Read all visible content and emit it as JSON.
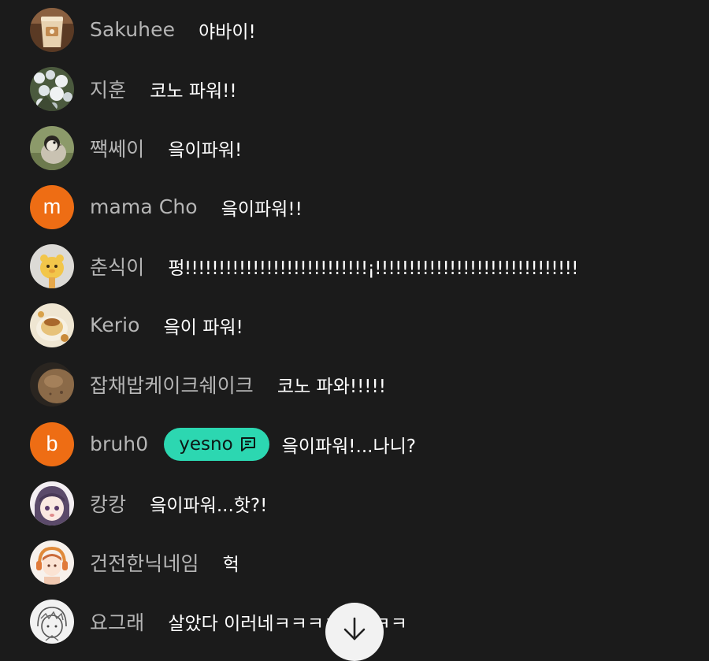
{
  "chat": {
    "messages": [
      {
        "nickname": "Sakuhee",
        "text": "야바이!",
        "avatar": "cup-avatar"
      },
      {
        "nickname": "지훈",
        "text": "코노 파워!!",
        "avatar": "flowers-avatar"
      },
      {
        "nickname": "짹쎄이",
        "text": "읔이파워!",
        "avatar": "bird-avatar"
      },
      {
        "nickname": "mama Cho",
        "text": "읔이파워!!",
        "avatar": "letter-avatar",
        "avatar_letter": "m"
      },
      {
        "nickname": "춘식이",
        "text": "펑!!!!!!!!!!!!!!!!!!!!!!!!!!!¡!!!!!!!!!!!!!!!!!!!!!!!!!!!!!!",
        "avatar": "character-avatar"
      },
      {
        "nickname": "Kerio",
        "text": "읔이 파워!",
        "avatar": "pudding-avatar"
      },
      {
        "nickname": "잡채밥케이크쉐이크",
        "text": "코노 파와!!!!!",
        "avatar": "potato-avatar"
      },
      {
        "nickname": "bruh0",
        "badge": "yesno",
        "text": "읔이파워!...나니?",
        "avatar": "letter-avatar",
        "avatar_letter": "b"
      },
      {
        "nickname": "캉캉",
        "text": "읔이파워...핫?!",
        "avatar": "anime-avatar"
      },
      {
        "nickname": "건전한닉네임",
        "text": "헉",
        "avatar": "headphones-avatar"
      },
      {
        "nickname": "요그래",
        "text": "살았다 이러네ㅋㅋㅋㅋㅋㅋㅋㅋ",
        "avatar": "sketch-avatar"
      }
    ]
  },
  "colors": {
    "background": "#1b1b1b",
    "nickname": "#b5b5b5",
    "message_text": "#ffffff",
    "letter_avatar": "#ee6d14",
    "badge": "#2cd7b1"
  },
  "scroll_button": {
    "icon": "arrow-down-icon"
  }
}
